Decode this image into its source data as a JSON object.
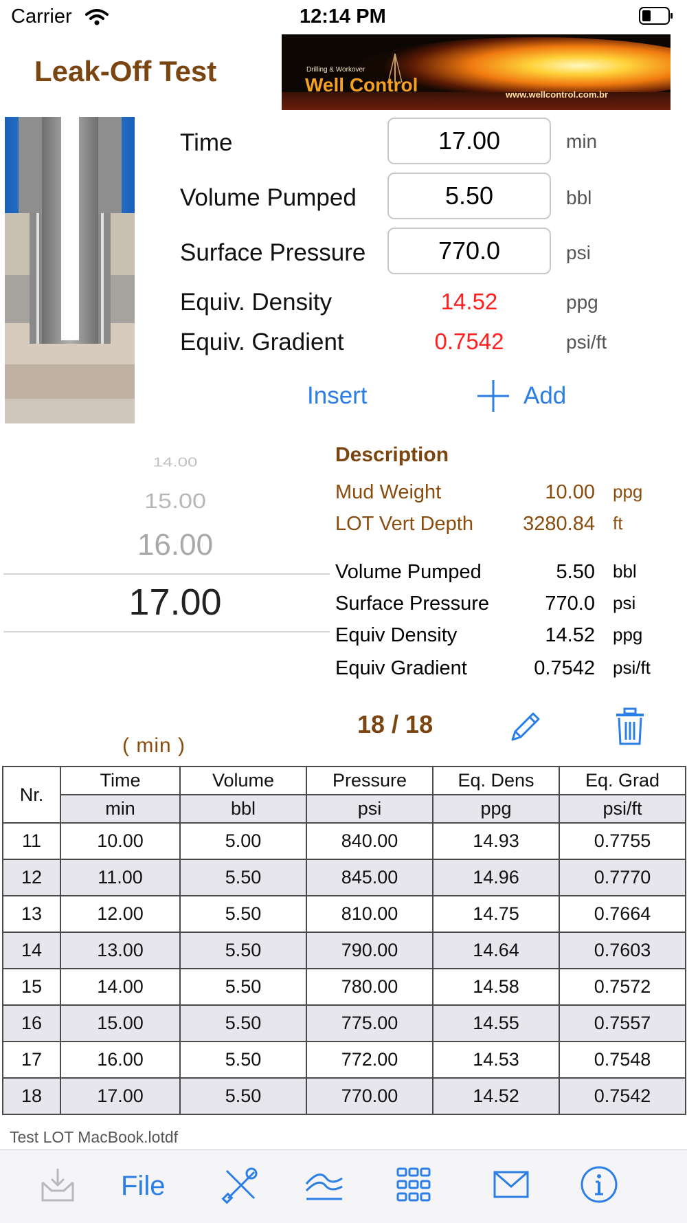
{
  "status_bar": {
    "carrier": "Carrier",
    "time": "12:14 PM"
  },
  "header": {
    "title": "Leak-Off Test",
    "banner": {
      "line1": "Drilling & Workover",
      "line2": "Well Control",
      "url": "www.wellcontrol.com.br"
    }
  },
  "form": {
    "time": {
      "label": "Time",
      "value": "17.00",
      "unit": "min"
    },
    "volume": {
      "label": "Volume Pumped",
      "value": "5.50",
      "unit": "bbl"
    },
    "pressure": {
      "label": "Surface Pressure",
      "value": "770.0",
      "unit": "psi"
    },
    "density": {
      "label": "Equiv. Density",
      "value": "14.52",
      "unit": "ppg"
    },
    "gradient": {
      "label": "Equiv. Gradient",
      "value": "0.7542",
      "unit": "psi/ft"
    },
    "insert_label": "Insert",
    "add_label": "Add"
  },
  "picker": {
    "values": [
      "14.00",
      "15.00",
      "16.00",
      "17.00"
    ],
    "unit_label": "(   min   )"
  },
  "description": {
    "title": "Description",
    "mud_weight": {
      "label": "Mud Weight",
      "value": "10.00",
      "unit": "ppg"
    },
    "lot_depth": {
      "label": "LOT Vert Depth",
      "value": "3280.84",
      "unit": "ft"
    },
    "volume": {
      "label": "Volume Pumped",
      "value": "5.50",
      "unit": "bbl"
    },
    "pressure": {
      "label": "Surface Pressure",
      "value": "770.0",
      "unit": "psi"
    },
    "density": {
      "label": "Equiv Density",
      "value": "14.52",
      "unit": "ppg"
    },
    "gradient": {
      "label": "Equiv Gradient",
      "value": "0.7542",
      "unit": "psi/ft"
    }
  },
  "counter": "18 / 18",
  "table": {
    "headers": [
      "Nr.",
      "Time",
      "Volume",
      "Pressure",
      "Eq. Dens",
      "Eq. Grad"
    ],
    "units": [
      "min",
      "bbl",
      "psi",
      "ppg",
      "psi/ft"
    ],
    "rows": [
      [
        "11",
        "10.00",
        "5.00",
        "840.00",
        "14.93",
        "0.7755"
      ],
      [
        "12",
        "11.00",
        "5.50",
        "845.00",
        "14.96",
        "0.7770"
      ],
      [
        "13",
        "12.00",
        "5.50",
        "810.00",
        "14.75",
        "0.7664"
      ],
      [
        "14",
        "13.00",
        "5.50",
        "790.00",
        "14.64",
        "0.7603"
      ],
      [
        "15",
        "14.00",
        "5.50",
        "780.00",
        "14.58",
        "0.7572"
      ],
      [
        "16",
        "15.00",
        "5.50",
        "775.00",
        "14.55",
        "0.7557"
      ],
      [
        "17",
        "16.00",
        "5.50",
        "772.00",
        "14.53",
        "0.7548"
      ],
      [
        "18",
        "17.00",
        "5.50",
        "770.00",
        "14.52",
        "0.7542"
      ]
    ]
  },
  "filename": "Test LOT MacBook.lotdf",
  "toolbar": {
    "file_label": "File",
    "icons": [
      "inbox-icon",
      "tools-icon",
      "chart-icon",
      "grid-icon",
      "mail-icon",
      "info-icon"
    ]
  },
  "colors": {
    "accent": "#2a7ee6",
    "brand_brown": "#7a4510",
    "result_red": "#ff2020"
  }
}
